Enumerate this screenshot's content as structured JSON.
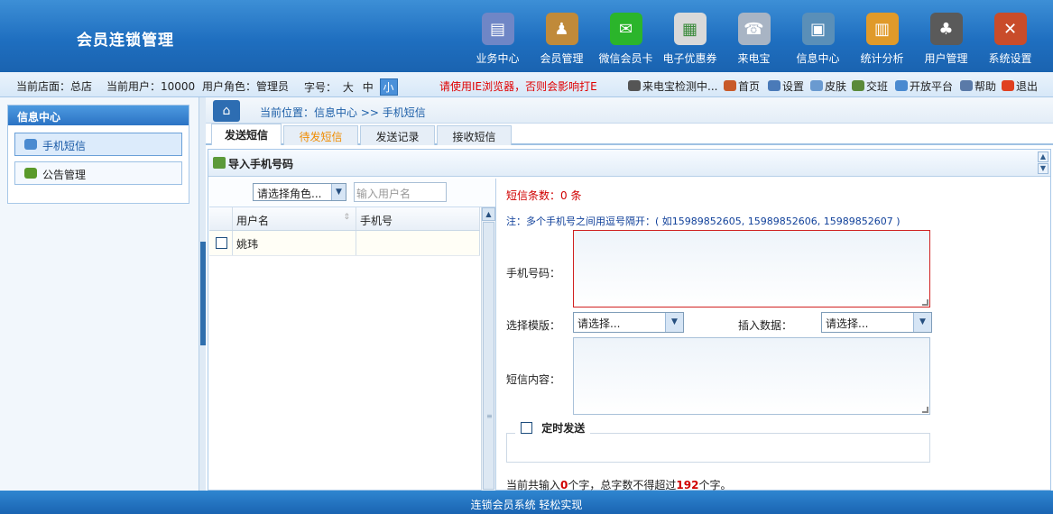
{
  "header": {
    "brand": "会员连锁管理",
    "nav": [
      {
        "label": "业务中心",
        "icon": "business-center-icon",
        "color": "#6f86c6"
      },
      {
        "label": "会员管理",
        "icon": "member-management-icon",
        "color": "#c08a3a"
      },
      {
        "label": "微信会员卡",
        "icon": "wechat-icon",
        "color": "#2bb52b"
      },
      {
        "label": "电子优惠券",
        "icon": "coupon-icon",
        "color": "#d9d9d9"
      },
      {
        "label": "来电宝",
        "icon": "telephone-icon",
        "color": "#a8b4c4"
      },
      {
        "label": "信息中心",
        "icon": "message-center-icon",
        "color": "#5a8fb8"
      },
      {
        "label": "统计分析",
        "icon": "bar-chart-icon",
        "color": "#e09a2a"
      },
      {
        "label": "用户管理",
        "icon": "user-management-icon",
        "color": "#5a5a5a"
      },
      {
        "label": "系统设置",
        "icon": "tools-icon",
        "color": "#c94c2a"
      }
    ]
  },
  "infobar": {
    "store": "当前店面：总店",
    "user": "当前用户：10000",
    "role": "用户角色：管理员",
    "font_label": "字号：",
    "font_sizes": [
      "大",
      "中",
      "小"
    ],
    "warning": "请使用IE浏览器，否则会影响打E",
    "phone_status": "来电宝检测中...",
    "links": [
      {
        "label": "首页",
        "icon": "home-icon",
        "color": "#c85a2a"
      },
      {
        "label": "设置",
        "icon": "settings-user-icon",
        "color": "#4a7ab8"
      },
      {
        "label": "皮肤",
        "icon": "skin-tag-icon",
        "color": "#6a9ad0"
      },
      {
        "label": "交班",
        "icon": "shift-change-icon",
        "color": "#5a8a3a"
      },
      {
        "label": "开放平台",
        "icon": "open-platform-icon",
        "color": "#4a8ad0"
      },
      {
        "label": "帮助",
        "icon": "help-icon",
        "color": "#5a7aa8"
      },
      {
        "label": "退出",
        "icon": "logout-icon",
        "color": "#e04020"
      }
    ]
  },
  "sidebar": {
    "title": "信息中心",
    "items": [
      {
        "label": "手机短信",
        "icon": "sms-icon",
        "active": true
      },
      {
        "label": "公告管理",
        "icon": "announcement-icon",
        "active": false
      }
    ]
  },
  "breadcrumb": "当前位置：信息中心 >> 手机短信",
  "tabs": [
    "发送短信",
    "待发短信",
    "发送记录",
    "接收短信"
  ],
  "panel": {
    "title": "导入手机号码",
    "role_select": "请选择角色...",
    "user_placeholder": "输入用户名",
    "columns": [
      "用户名",
      "手机号"
    ],
    "rows": [
      {
        "name": "姚玮",
        "phone": ""
      }
    ]
  },
  "sms_form": {
    "count_label": "短信条数：0 条",
    "note": "注：多个手机号之间用逗号隔开：( 如15989852605, 15989852606, 15989852607 )",
    "phone_label": "手机号码：",
    "template_label": "选择模版：",
    "template_value": "请选择...",
    "insert_label": "插入数据：",
    "insert_value": "请选择...",
    "content_label": "短信内容：",
    "scheduled_label": "定时发送",
    "summary_prefix": "当前共输入",
    "summary_count": "0",
    "summary_mid": "个字，总字数不得超过",
    "summary_limit": "192",
    "summary_suffix": "个字。"
  },
  "footer": "连锁会员系统 轻松实现"
}
